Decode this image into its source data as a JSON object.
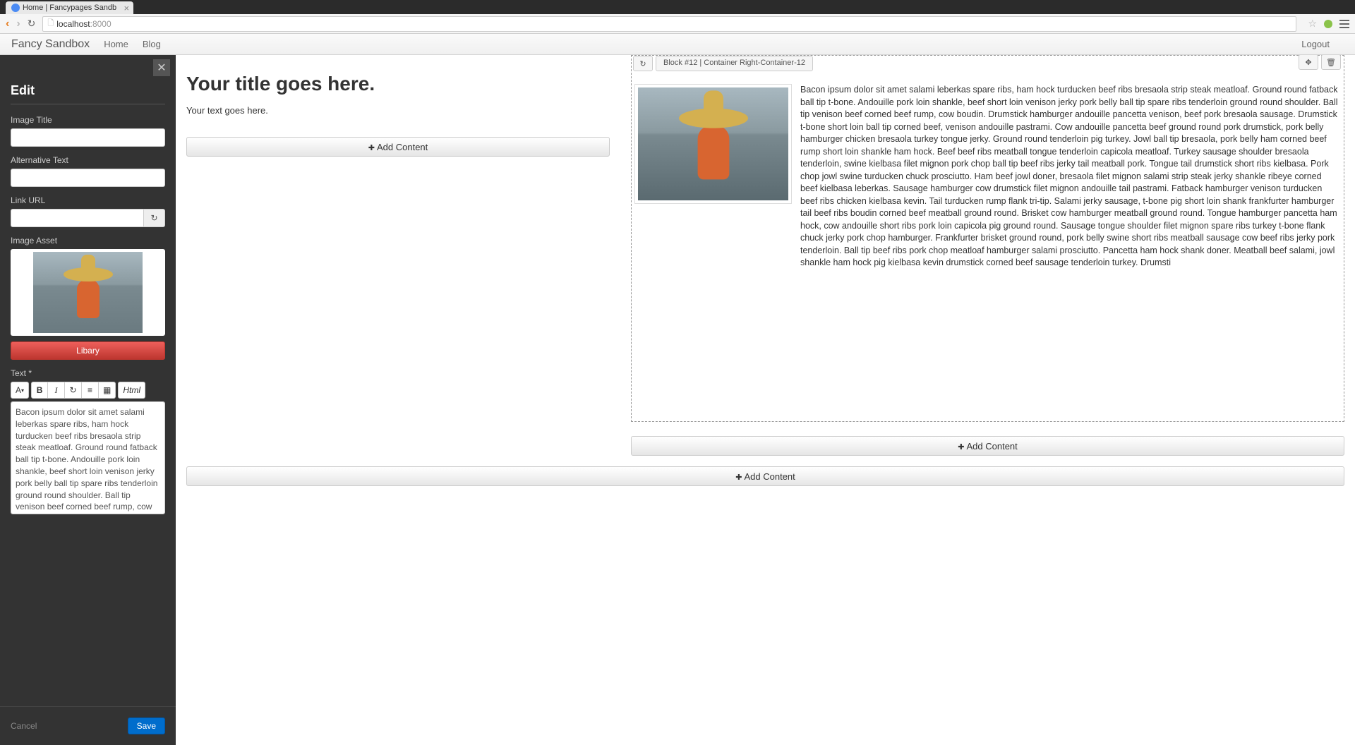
{
  "browser": {
    "tab_title": "Home | Fancypages Sandb",
    "url_host": "localhost",
    "url_port": ":8000"
  },
  "navbar": {
    "brand": "Fancy Sandbox",
    "links": [
      "Home",
      "Blog"
    ],
    "logout": "Logout"
  },
  "sidebar": {
    "heading": "Edit",
    "fields": {
      "image_title": {
        "label": "Image Title",
        "value": ""
      },
      "alt_text": {
        "label": "Alternative Text",
        "value": ""
      },
      "link_url": {
        "label": "Link URL",
        "value": ""
      },
      "image_asset": {
        "label": "Image Asset"
      },
      "text": {
        "label": "Text *"
      }
    },
    "library_btn": "Libary",
    "editor_buttons": {
      "font": "A",
      "bold": "B",
      "italic": "I",
      "redo": "↻",
      "list": "≡",
      "table": "▦",
      "html": "Html"
    },
    "textarea_value": "Bacon ipsum dolor sit amet salami leberkas spare ribs, ham hock turducken beef ribs bresaola strip steak meatloaf. Ground round fatback ball tip t-bone. Andouille pork loin shankle, beef short loin venison jerky pork belly ball tip spare ribs tenderloin ground round shoulder. Ball tip venison beef corned beef rump, cow boudin. Drumstick hamburger",
    "cancel": "Cancel",
    "save": "Save"
  },
  "main": {
    "title": "Your title goes here.",
    "text": "Your text goes here.",
    "add_content": "Add Content"
  },
  "block": {
    "header": "Block #12 | Container Right-Container-12",
    "text": "Bacon ipsum dolor sit amet salami leberkas spare ribs, ham hock turducken beef ribs bresaola strip steak meatloaf. Ground round fatback ball tip t-bone. Andouille pork loin shankle, beef short loin venison jerky pork belly ball tip spare ribs tenderloin ground round shoulder. Ball tip venison beef corned beef rump, cow boudin. Drumstick hamburger andouille pancetta venison, beef pork bresaola sausage. Drumstick t-bone short loin ball tip corned beef, venison andouille pastrami. Cow andouille pancetta beef ground round pork drumstick, pork belly hamburger chicken bresaola turkey tongue jerky. Ground round tenderloin pig turkey. Jowl ball tip bresaola, pork belly ham corned beef rump short loin shankle ham hock. Beef beef ribs meatball tongue tenderloin capicola meatloaf. Turkey sausage shoulder bresaola tenderloin, swine kielbasa filet mignon pork chop ball tip beef ribs jerky tail meatball pork. Tongue tail drumstick short ribs kielbasa. Pork chop jowl swine turducken chuck prosciutto. Ham beef jowl doner, bresaola filet mignon salami strip steak jerky shankle ribeye corned beef kielbasa leberkas. Sausage hamburger cow drumstick filet mignon andouille tail pastrami. Fatback hamburger venison turducken beef ribs chicken kielbasa kevin. Tail turducken rump flank tri-tip. Salami jerky sausage, t-bone pig short loin shank frankfurter hamburger tail beef ribs boudin corned beef meatball ground round. Brisket cow hamburger meatball ground round. Tongue hamburger pancetta ham hock, cow andouille short ribs pork loin capicola pig ground round. Sausage tongue shoulder filet mignon spare ribs turkey t-bone flank chuck jerky pork chop hamburger. Frankfurter brisket ground round, pork belly swine short ribs meatball sausage cow beef ribs jerky pork tenderloin. Ball tip beef ribs pork chop meatloaf hamburger salami prosciutto. Pancetta ham hock shank doner. Meatball beef salami, jowl shankle ham hock pig kielbasa kevin drumstick corned beef sausage tenderloin turkey. Drumsti"
  }
}
